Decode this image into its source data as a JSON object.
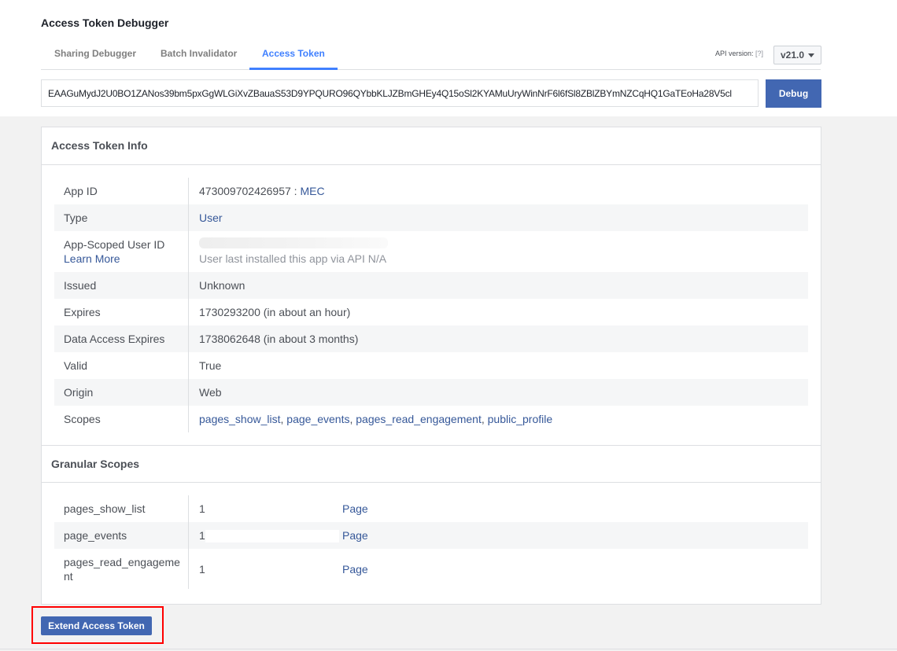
{
  "title": "Access Token Debugger",
  "tabs": [
    {
      "label": "Sharing Debugger"
    },
    {
      "label": "Batch Invalidator"
    },
    {
      "label": "Access Token",
      "active": true
    }
  ],
  "api_version": {
    "label": "API version:",
    "help": "[?]",
    "value": "v21.0"
  },
  "token_input": {
    "value": "EAAGuMydJ2U0BO1ZANos39bm5pxGgWLGiXvZBauaS53D9YPQURO96QYbbKLJZBmGHEy4Q15oSl2KYAMuUryWinNrF6l6fSl8ZBlZBYmNZCqHQ1GaTEoHa28V5cl"
  },
  "debug_label": "Debug",
  "info": {
    "header": "Access Token Info",
    "app_id": {
      "label": "App ID",
      "value": "473009702426957 : ",
      "app_name": "MEC"
    },
    "type": {
      "label": "Type",
      "value": "User"
    },
    "app_scoped": {
      "label": "App-Scoped User ID",
      "learn_more": "Learn More",
      "note": "User last installed this app via API N/A"
    },
    "issued": {
      "label": "Issued",
      "value": "Unknown"
    },
    "expires": {
      "label": "Expires",
      "value": "1730293200 (in about an hour)"
    },
    "data_access": {
      "label": "Data Access Expires",
      "value": "1738062648 (in about 3 months)"
    },
    "valid": {
      "label": "Valid",
      "value": "True"
    },
    "origin": {
      "label": "Origin",
      "value": "Web"
    },
    "scopes": {
      "label": "Scopes",
      "items": [
        "pages_show_list",
        ", ",
        "page_events",
        ", ",
        "pages_read_engagement",
        ", ",
        "public_profile"
      ]
    }
  },
  "granular": {
    "header": "Granular Scopes",
    "rows": [
      {
        "scope": "pages_show_list",
        "id": "1",
        "type": "Page"
      },
      {
        "scope": "page_events",
        "id": "1",
        "type": "Page"
      },
      {
        "scope": "pages_read_engagement",
        "id": "1",
        "type": "Page"
      }
    ]
  },
  "extend_label": "Extend Access Token",
  "colors": {
    "accent": "#4267b2",
    "tab_active": "#4080ff",
    "link": "#365899",
    "highlight": "#ff0000"
  }
}
